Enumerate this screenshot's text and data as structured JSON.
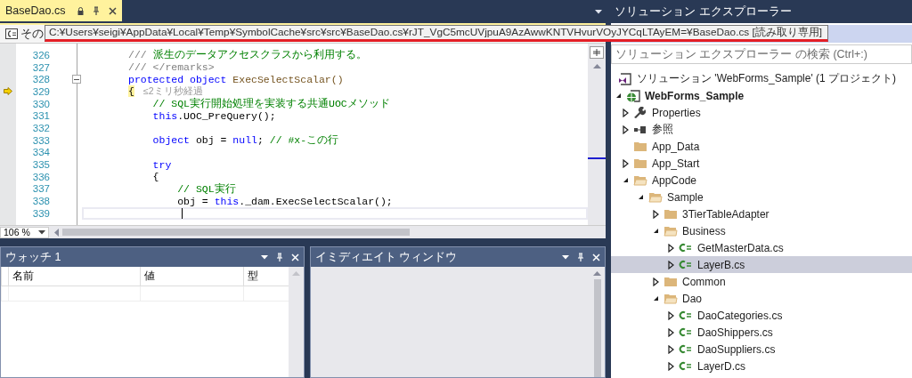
{
  "editor": {
    "tab": {
      "label": "BaseDao.cs",
      "selected": true
    },
    "nav_dropdown": "その",
    "tooltip": "C:¥Users¥seigi¥AppData¥Local¥Temp¥SymbolCache¥src¥src¥BaseDao.cs¥rJT_VgC5mcUVjpuA9AzAwwKNTVHvurVOyJYCqLTAyEM=¥BaseDao.cs [読み取り専用]",
    "lines": [
      {
        "number": "326",
        "tokens": [
          {
            "kind": "doc",
            "text": "/// "
          },
          {
            "kind": "comment",
            "text": "派生のデータアクセスクラスから利用する。"
          }
        ]
      },
      {
        "number": "327",
        "tokens": [
          {
            "kind": "doc",
            "text": "/// </remarks>"
          }
        ]
      },
      {
        "number": "328",
        "fold": true,
        "tokens": [
          {
            "kind": "keyword",
            "text": "protected object "
          },
          {
            "kind": "method",
            "text": "ExecSelectScalar()"
          }
        ]
      },
      {
        "number": "329",
        "exec": true,
        "tokens": [
          {
            "kind": "brace",
            "text": "{"
          },
          {
            "kind": "lens",
            "text": "≤2ミリ秒経過"
          }
        ]
      },
      {
        "number": "330",
        "tokens": [
          {
            "kind": "comment",
            "text": "    // SQL実行開始処理を実装する共通UOCメソッド"
          }
        ]
      },
      {
        "number": "331",
        "tokens": [
          {
            "kind": "keyword",
            "text": "    this"
          },
          {
            "kind": "plain",
            "text": ".UOC_PreQuery();"
          }
        ]
      },
      {
        "number": "332"
      },
      {
        "number": "333",
        "tokens": [
          {
            "kind": "keyword",
            "text": "    object"
          },
          {
            "kind": "plain",
            "text": " obj = "
          },
          {
            "kind": "keyword",
            "text": "null"
          },
          {
            "kind": "plain",
            "text": "; "
          },
          {
            "kind": "comment",
            "text": "// #x-この行"
          }
        ]
      },
      {
        "number": "334"
      },
      {
        "number": "335",
        "tokens": [
          {
            "kind": "keyword",
            "text": "    try"
          }
        ]
      },
      {
        "number": "336",
        "tokens": [
          {
            "kind": "plain",
            "text": "    {"
          }
        ]
      },
      {
        "number": "337",
        "tokens": [
          {
            "kind": "comment",
            "text": "        // SQL実行"
          }
        ]
      },
      {
        "number": "338",
        "tokens": [
          {
            "kind": "plain",
            "text": "        obj = "
          },
          {
            "kind": "keyword",
            "text": "this"
          },
          {
            "kind": "plain",
            "text": "._dam.ExecSelectScalar();"
          }
        ]
      },
      {
        "number": "339",
        "current": true
      }
    ],
    "zoom": "106 %"
  },
  "watch": {
    "title": "ウォッチ 1",
    "columns": [
      "名前",
      "値",
      "型"
    ]
  },
  "immediate": {
    "title": "イミディエイト ウィンドウ"
  },
  "solution_explorer": {
    "title": "ソリューション エクスプローラー",
    "search": {
      "placeholder": "ソリューション エクスプローラー の検索 (Ctrl+:)"
    },
    "tree": [
      {
        "label": "ソリューション 'WebForms_Sample' (1 プロジェクト)",
        "kind": "solution",
        "selected": false,
        "children": [
          {
            "label": "WebForms_Sample",
            "kind": "project",
            "expanded": true,
            "selected": false,
            "children": [
              {
                "label": "Properties",
                "kind": "wrench",
                "expanded": false,
                "selected": false
              },
              {
                "label": "参照",
                "kind": "references",
                "expanded": false,
                "selected": false
              },
              {
                "label": "App_Data",
                "kind": "folder",
                "selected": false
              },
              {
                "label": "App_Start",
                "kind": "folder",
                "expanded": false,
                "selected": false
              },
              {
                "label": "AppCode",
                "kind": "folder",
                "expanded": true,
                "selected": false,
                "children": [
                  {
                    "label": "Sample",
                    "kind": "folder",
                    "expanded": true,
                    "selected": false,
                    "children": [
                      {
                        "label": "3TierTableAdapter",
                        "kind": "folder",
                        "expanded": false,
                        "selected": false
                      },
                      {
                        "label": "Business",
                        "kind": "folder",
                        "expanded": true,
                        "selected": false,
                        "children": [
                          {
                            "label": "GetMasterData.cs",
                            "kind": "csharp",
                            "expanded": false,
                            "selected": false
                          },
                          {
                            "label": "LayerB.cs",
                            "kind": "csharp",
                            "expanded": false,
                            "selected": true
                          }
                        ]
                      },
                      {
                        "label": "Common",
                        "kind": "folder",
                        "expanded": false,
                        "selected": false
                      },
                      {
                        "label": "Dao",
                        "kind": "folder",
                        "expanded": true,
                        "selected": false,
                        "children": [
                          {
                            "label": "DaoCategories.cs",
                            "kind": "csharp",
                            "expanded": false,
                            "selected": false
                          },
                          {
                            "label": "DaoShippers.cs",
                            "kind": "csharp",
                            "expanded": false,
                            "selected": false
                          },
                          {
                            "label": "DaoSuppliers.cs",
                            "kind": "csharp",
                            "expanded": false,
                            "selected": false
                          },
                          {
                            "label": "LayerD.cs",
                            "kind": "csharp",
                            "expanded": false,
                            "selected": false
                          }
                        ]
                      }
                    ]
                  }
                ]
              }
            ]
          }
        ]
      }
    ]
  }
}
